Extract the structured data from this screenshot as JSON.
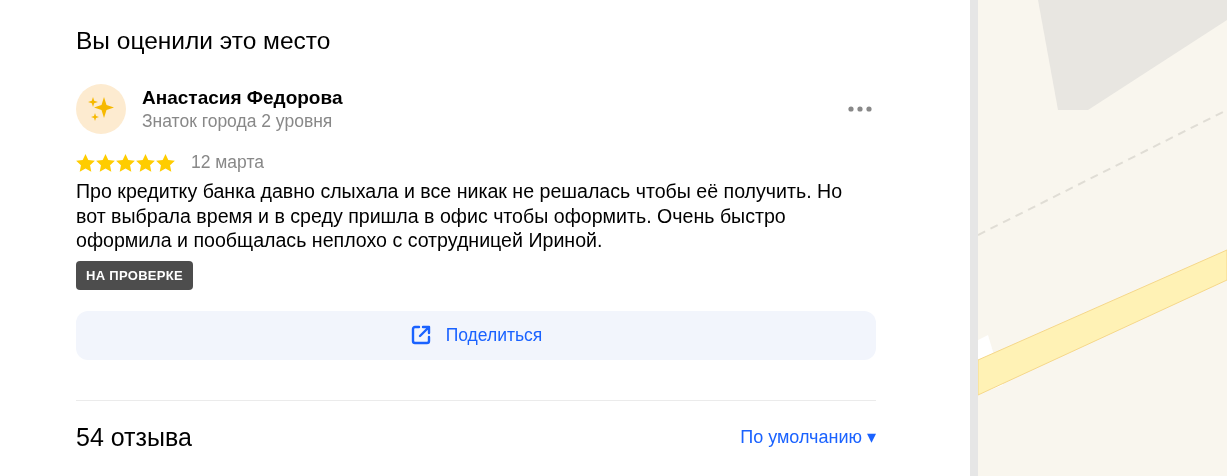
{
  "heading": "Вы оценили это место",
  "review": {
    "author": "Анастасия Федорова",
    "author_level": "Знаток города 2 уровня",
    "stars": 5,
    "date": "12 марта",
    "text": "Про кредитку банка давно слыхала и все никак не решалась чтобы её получить. Но вот выбрала время и в среду пришла в офис чтобы оформить. Очень быстро оформила и пообщалась неплохо с сотрудницей Ириной.",
    "status_badge": "НА ПРОВЕРКЕ",
    "share_button": "Поделиться"
  },
  "reviews_count": "54 отзыва",
  "sort": {
    "label": "По умолчанию",
    "caret": "▾"
  }
}
